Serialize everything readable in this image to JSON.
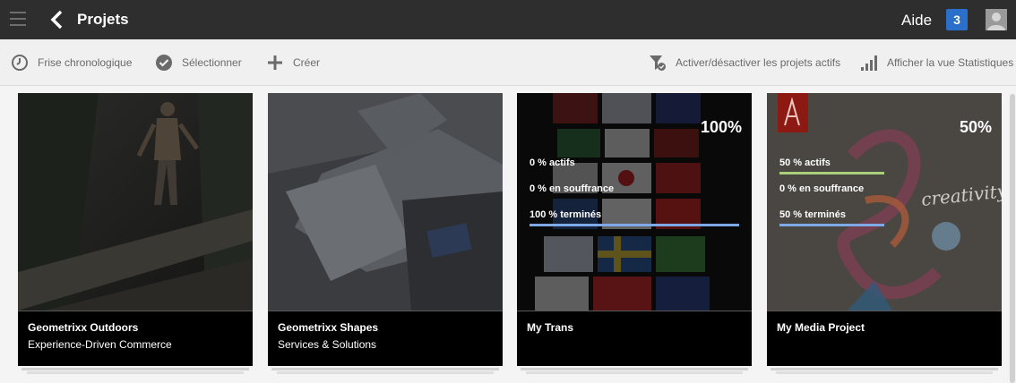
{
  "header": {
    "title": "Projets",
    "help_label": "Aide",
    "notification_count": "3"
  },
  "actions": {
    "timeline": "Frise chronologique",
    "select": "Sélectionner",
    "create": "Créer",
    "toggle_active": "Activer/désactiver les projets actifs",
    "stats": "Afficher la vue Statistiques"
  },
  "cards": [
    {
      "name": "Geometrixx Outdoors",
      "description": "Experience-Driven Commerce"
    },
    {
      "name": "Geometrixx Shapes",
      "description": "Services & Solutions"
    },
    {
      "name": "My Trans",
      "percent": "100%",
      "stats": {
        "active": "0 % actifs",
        "overdue": "0 % en souffrance",
        "completed": "100 % terminés"
      },
      "levels": {
        "active": 0,
        "overdue": 0,
        "completed": 1.0
      }
    },
    {
      "name": "My Media Project",
      "percent": "50%",
      "stats": {
        "active": "50 % actifs",
        "overdue": "0 % en souffrance",
        "completed": "50 % terminés"
      },
      "levels": {
        "active": 0.5,
        "overdue": 0,
        "completed": 0.5
      },
      "thumb_text": "creativity"
    }
  ],
  "colors": {
    "header_bg": "#2e2e2e",
    "badge": "#2a6fc9",
    "active_bar": "#a8cf7a",
    "completed_bar": "#7fa9e6"
  }
}
